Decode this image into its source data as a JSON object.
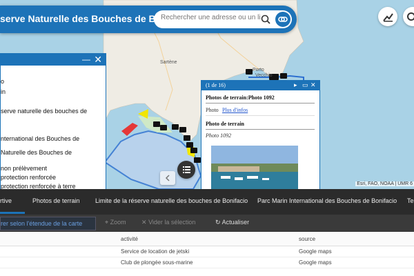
{
  "header": {
    "title": "serve Naturelle des Bouches de Bonifacio"
  },
  "search": {
    "placeholder": "Rechercher une adresse ou un lieu"
  },
  "map": {
    "labels": {
      "sartene": "Sartène",
      "porto_vecchio_1": "Porto",
      "porto_vecchio_2": "Vecchio"
    },
    "attribution": "Esri, FAO, NOAA | UMR 6"
  },
  "left_panel": {
    "layers": [
      "o",
      "in",
      "serve naturelle des bouches de",
      "",
      "nternational des Bouches de",
      "Naturelle des Bouches de",
      "",
      "non prélèvement",
      "protection renforcée",
      "protection renforcée à terre"
    ]
  },
  "popup": {
    "count": "(1 de 16)",
    "section1_title": "Photos de terrain:Photo 1092",
    "photo_label": "Photo",
    "more_info": "Plus d'infos",
    "section2_title": "Photo de terrain",
    "caption": "Photo 1092"
  },
  "tabs": [
    "rtive",
    "Photos de terrain",
    "Limite de la réserve naturelle des bouches de Bonifacio",
    "Parc Marin International des Bouches de Bonifacio",
    "Terr"
  ],
  "toolbar": {
    "filter": "rer selon l'étendue de la carte",
    "zoom": "Zoom",
    "clear": "Vider la sélection",
    "refresh": "Actualiser"
  },
  "table": {
    "columns": [
      "activité",
      "source"
    ],
    "rows": [
      {
        "activite": "Service de location de jetski",
        "source": "Google maps"
      },
      {
        "activite": "Club de plongée sous-marine",
        "source": "Google maps"
      }
    ]
  },
  "colors": {
    "accent": "#1d73b8",
    "tabbar": "#2b2b2b"
  }
}
